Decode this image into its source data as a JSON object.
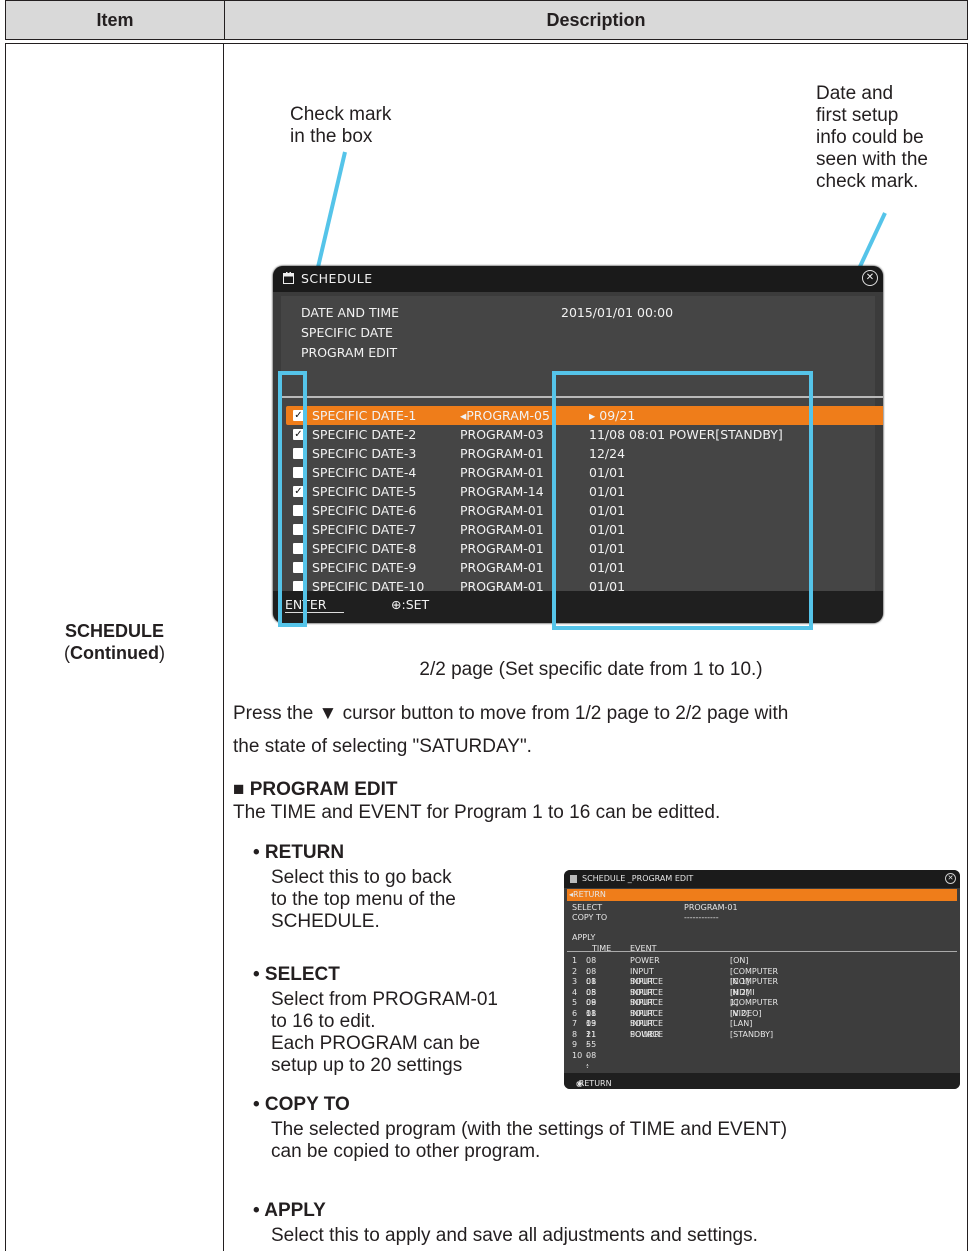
{
  "table": {
    "header_item": "Item",
    "header_description": "Description",
    "item_name": "SCHEDULE",
    "item_continued_open": "(",
    "item_continued": "Continued",
    "item_continued_close": ")"
  },
  "annotations": {
    "check_mark_line1": "Check mark",
    "check_mark_line2": "in the box",
    "date_info_lines": [
      "Date and",
      "first setup",
      "info could be",
      "seen with the",
      "check mark."
    ]
  },
  "osd": {
    "title": "SCHEDULE",
    "menu": [
      "DATE AND TIME",
      "SPECIFIC DATE",
      "PROGRAM EDIT"
    ],
    "date_value": "2015/01/01 00:00",
    "rows": [
      {
        "checked": true,
        "name": "SPECIFIC DATE-1",
        "program": "◂PROGRAM-05",
        "info": "▸ 09/21",
        "selected": true
      },
      {
        "checked": true,
        "name": "SPECIFIC DATE-2",
        "program": "PROGRAM-03",
        "info": "11/08 08:01 POWER[STANDBY]"
      },
      {
        "checked": false,
        "name": "SPECIFIC DATE-3",
        "program": "PROGRAM-01",
        "info": "12/24"
      },
      {
        "checked": false,
        "name": "SPECIFIC DATE-4",
        "program": "PROGRAM-01",
        "info": "01/01"
      },
      {
        "checked": true,
        "name": "SPECIFIC DATE-5",
        "program": "PROGRAM-14",
        "info": "01/01"
      },
      {
        "checked": false,
        "name": "SPECIFIC DATE-6",
        "program": "PROGRAM-01",
        "info": "01/01"
      },
      {
        "checked": false,
        "name": "SPECIFIC DATE-7",
        "program": "PROGRAM-01",
        "info": "01/01"
      },
      {
        "checked": false,
        "name": "SPECIFIC DATE-8",
        "program": "PROGRAM-01",
        "info": "01/01"
      },
      {
        "checked": false,
        "name": "SPECIFIC DATE-9",
        "program": "PROGRAM-01",
        "info": "01/01"
      },
      {
        "checked": false,
        "name": "SPECIFIC DATE-10",
        "program": "PROGRAM-01",
        "info": "01/01"
      }
    ],
    "footer_enter": "ENTER",
    "footer_set": ":SET",
    "accent_color": "#ef7d1a",
    "highlight_color": "#55c4e9"
  },
  "caption": "2/2 page (Set specific date from 1 to 10.)",
  "paragraph_line1": "Press the ▼ cursor button to move from 1/2 page to 2/2 page with",
  "paragraph_line2": "the state of selecting \"SATURDAY\".",
  "program_edit": {
    "heading": "■ PROGRAM EDIT",
    "intro": "The TIME and EVENT for Program 1 to 16 can be editted.",
    "return_title": "• RETURN",
    "return_lines": [
      "Select this to go back",
      "to the top menu of the",
      "SCHEDULE."
    ],
    "select_title": "• SELECT",
    "select_lines": [
      "Select from PROGRAM-01",
      "to 16 to edit.",
      "Each PROGRAM can be",
      "setup up to 20 settings"
    ],
    "copy_title": "• COPY TO",
    "copy_lines": [
      "The selected program (with the settings of TIME and EVENT)",
      "can be copied to other program."
    ],
    "apply_title": "• APPLY",
    "apply_lines": [
      "Select this to apply and save all adjustments and settings."
    ]
  },
  "pe_screen": {
    "title": "SCHEDULE _PROGRAM EDIT",
    "return_label": "◂RETURN",
    "select_label": "SELECT",
    "select_value": "PROGRAM-01",
    "copy_label": "COPY TO",
    "copy_value": "------------",
    "apply_label": "APPLY",
    "col_time": "TIME",
    "col_event": "EVENT",
    "rows": [
      {
        "n": "1",
        "time": "08 : 01",
        "event": "POWER",
        "value": "[ON]"
      },
      {
        "n": "2",
        "time": "08 : 05",
        "event": "INPUT SOURCE",
        "value": "[COMPUTER IN 1]"
      },
      {
        "n": "3",
        "time": "08 : 09",
        "event": "INPUT SOURCE",
        "value": "[COMPUTER IN 2]"
      },
      {
        "n": "4",
        "time": "08 : 11",
        "event": "INPUT SOURCE",
        "value": "[HDMI 1]"
      },
      {
        "n": "5",
        "time": "08 : 13",
        "event": "INPUT SOURCE",
        "value": "[COMPUTER IN 2]"
      },
      {
        "n": "6",
        "time": "08 : 21",
        "event": "INPUT SOURCE",
        "value": "[VIDEO]"
      },
      {
        "n": "7",
        "time": "09 : 55",
        "event": "INPUT SOURCE",
        "value": "[LAN]"
      },
      {
        "n": "8",
        "time": "11 : 08",
        "event": "POWER",
        "value": "[STANDBY]"
      },
      {
        "n": "9",
        "time": "-- : --",
        "event": "",
        "value": ""
      },
      {
        "n": "10",
        "time": "-- : --",
        "event": "",
        "value": ""
      }
    ],
    "footer": ":RETURN"
  }
}
